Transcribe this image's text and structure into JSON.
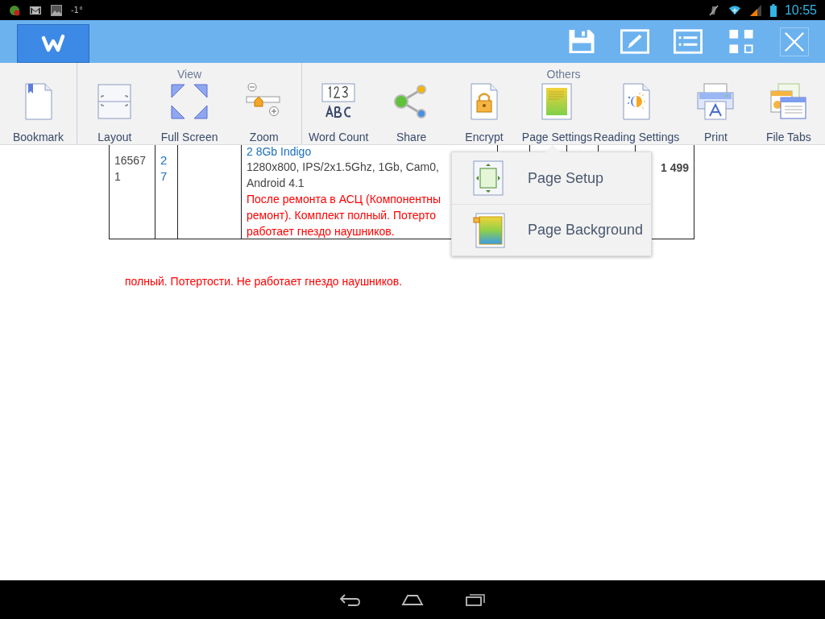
{
  "status_bar": {
    "temperature": "-1°",
    "time": "10:55"
  },
  "toolbar": {
    "groups": [
      {
        "items": [
          {
            "kind": "bookmark",
            "label": "Bookmark"
          }
        ]
      },
      {
        "title": "View",
        "items": [
          {
            "kind": "layout",
            "label": "Layout"
          },
          {
            "kind": "fullscreen",
            "label": "Full Screen"
          },
          {
            "kind": "zoom",
            "label": "Zoom"
          }
        ]
      },
      {
        "title": "Others",
        "items": [
          {
            "kind": "wordcount",
            "label": "Word Count"
          },
          {
            "kind": "share",
            "label": "Share"
          },
          {
            "kind": "encrypt",
            "label": "Encrypt"
          },
          {
            "kind": "pagesettings",
            "label": "Page Settings"
          },
          {
            "kind": "reading",
            "label": "Reading Settings"
          },
          {
            "kind": "print",
            "label": "Print"
          },
          {
            "kind": "filetabs",
            "label": "File Tabs"
          }
        ]
      }
    ]
  },
  "document": {
    "row": {
      "code": [
        "16567",
        "1"
      ],
      "quantity": [
        "2",
        "7"
      ],
      "title": "2 8Gb Indigo",
      "spec_lines": [
        "1280x800, IPS/2x1.5Ghz, 1Gb, Cam0,",
        "Android 4.1"
      ],
      "note_lines": [
        "После ремонта в АСЦ (Компонентны",
        "ремонт). Комплект полный. Потерто",
        "работает гнездо наушников."
      ],
      "price": "1 499"
    },
    "note": "полный. Потертости. Не работает гнездо наушников."
  },
  "popup_menu": {
    "items": [
      {
        "kind": "setup",
        "label": "Page Setup"
      },
      {
        "kind": "background",
        "label": "Page Background"
      }
    ]
  }
}
